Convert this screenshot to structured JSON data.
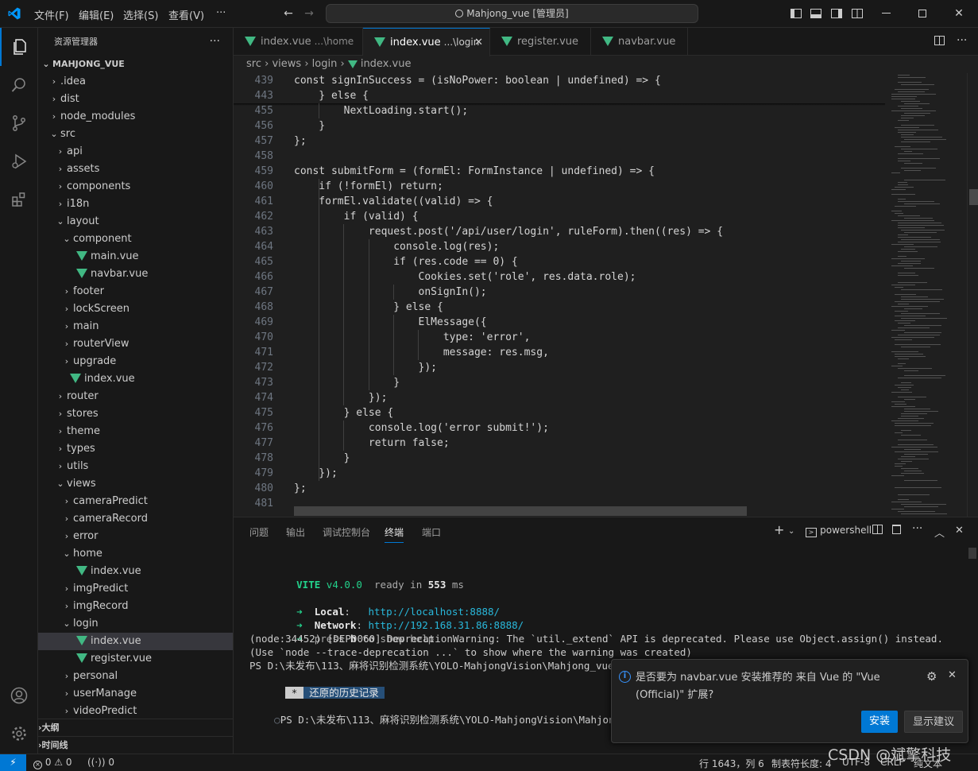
{
  "titlebar": {
    "menus": [
      "文件(F)",
      "编辑(E)",
      "选择(S)",
      "查看(V)",
      "···"
    ],
    "search": "Mahjong_vue [管理员]"
  },
  "sidebar": {
    "title": "资源管理器",
    "more": "···",
    "root": "MAHJONG_VUE",
    "items": [
      {
        "label": ".idea",
        "depth": 1,
        "kind": "folder",
        "open": false
      },
      {
        "label": "dist",
        "depth": 1,
        "kind": "folder",
        "open": false
      },
      {
        "label": "node_modules",
        "depth": 1,
        "kind": "folder",
        "open": false
      },
      {
        "label": "src",
        "depth": 1,
        "kind": "folder",
        "open": true
      },
      {
        "label": "api",
        "depth": 2,
        "kind": "folder",
        "open": false
      },
      {
        "label": "assets",
        "depth": 2,
        "kind": "folder",
        "open": false
      },
      {
        "label": "components",
        "depth": 2,
        "kind": "folder",
        "open": false
      },
      {
        "label": "i18n",
        "depth": 2,
        "kind": "folder",
        "open": false
      },
      {
        "label": "layout",
        "depth": 2,
        "kind": "folder",
        "open": true
      },
      {
        "label": "component",
        "depth": 3,
        "kind": "folder",
        "open": true
      },
      {
        "label": "main.vue",
        "depth": 4,
        "kind": "vue"
      },
      {
        "label": "navbar.vue",
        "depth": 4,
        "kind": "vue"
      },
      {
        "label": "footer",
        "depth": 3,
        "kind": "folder",
        "open": false
      },
      {
        "label": "lockScreen",
        "depth": 3,
        "kind": "folder",
        "open": false
      },
      {
        "label": "main",
        "depth": 3,
        "kind": "folder",
        "open": false
      },
      {
        "label": "routerView",
        "depth": 3,
        "kind": "folder",
        "open": false
      },
      {
        "label": "upgrade",
        "depth": 3,
        "kind": "folder",
        "open": false
      },
      {
        "label": "index.vue",
        "depth": 3,
        "kind": "vue"
      },
      {
        "label": "router",
        "depth": 2,
        "kind": "folder",
        "open": false
      },
      {
        "label": "stores",
        "depth": 2,
        "kind": "folder",
        "open": false
      },
      {
        "label": "theme",
        "depth": 2,
        "kind": "folder",
        "open": false
      },
      {
        "label": "types",
        "depth": 2,
        "kind": "folder",
        "open": false
      },
      {
        "label": "utils",
        "depth": 2,
        "kind": "folder",
        "open": false
      },
      {
        "label": "views",
        "depth": 2,
        "kind": "folder",
        "open": true
      },
      {
        "label": "cameraPredict",
        "depth": 3,
        "kind": "folder",
        "open": false
      },
      {
        "label": "cameraRecord",
        "depth": 3,
        "kind": "folder",
        "open": false
      },
      {
        "label": "error",
        "depth": 3,
        "kind": "folder",
        "open": false
      },
      {
        "label": "home",
        "depth": 3,
        "kind": "folder",
        "open": true
      },
      {
        "label": "index.vue",
        "depth": 4,
        "kind": "vue"
      },
      {
        "label": "imgPredict",
        "depth": 3,
        "kind": "folder",
        "open": false
      },
      {
        "label": "imgRecord",
        "depth": 3,
        "kind": "folder",
        "open": false
      },
      {
        "label": "login",
        "depth": 3,
        "kind": "folder",
        "open": true
      },
      {
        "label": "index.vue",
        "depth": 4,
        "kind": "vue",
        "selected": true
      },
      {
        "label": "register.vue",
        "depth": 4,
        "kind": "vue"
      },
      {
        "label": "personal",
        "depth": 3,
        "kind": "folder",
        "open": false
      },
      {
        "label": "userManage",
        "depth": 3,
        "kind": "folder",
        "open": false
      },
      {
        "label": "videoPredict",
        "depth": 3,
        "kind": "folder",
        "open": false
      }
    ],
    "outline": "大纲",
    "timeline": "时间线"
  },
  "tabs": [
    {
      "label": "index.vue",
      "desc": "...\\home",
      "active": false
    },
    {
      "label": "index.vue",
      "desc": "...\\login",
      "active": true
    },
    {
      "label": "register.vue",
      "desc": "",
      "active": false
    },
    {
      "label": "navbar.vue",
      "desc": "",
      "active": false
    }
  ],
  "breadcrumb": [
    "src",
    "views",
    "login",
    "index.vue"
  ],
  "code": [
    {
      "ln": "439",
      "text": "const signInSuccess = (isNoPower: boolean | undefined) => {"
    },
    {
      "ln": "443",
      "text": "    } else {"
    },
    {
      "ln": "455",
      "text": "        NextLoading.start();"
    },
    {
      "ln": "456",
      "text": "    }"
    },
    {
      "ln": "457",
      "text": "};"
    },
    {
      "ln": "458",
      "text": ""
    },
    {
      "ln": "459",
      "text": "const submitForm = (formEl: FormInstance | undefined) => {"
    },
    {
      "ln": "460",
      "text": "    if (!formEl) return;"
    },
    {
      "ln": "461",
      "text": "    formEl.validate((valid) => {"
    },
    {
      "ln": "462",
      "text": "        if (valid) {"
    },
    {
      "ln": "463",
      "text": "            request.post('/api/user/login', ruleForm).then((res) => {"
    },
    {
      "ln": "464",
      "text": "                console.log(res);"
    },
    {
      "ln": "465",
      "text": "                if (res.code == 0) {"
    },
    {
      "ln": "466",
      "text": "                    Cookies.set('role', res.data.role);"
    },
    {
      "ln": "467",
      "text": "                    onSignIn();"
    },
    {
      "ln": "468",
      "text": "                } else {"
    },
    {
      "ln": "469",
      "text": "                    ElMessage({"
    },
    {
      "ln": "470",
      "text": "                        type: 'error',"
    },
    {
      "ln": "471",
      "text": "                        message: res.msg,"
    },
    {
      "ln": "472",
      "text": "                    });"
    },
    {
      "ln": "473",
      "text": "                }"
    },
    {
      "ln": "474",
      "text": "            });"
    },
    {
      "ln": "475",
      "text": "        } else {"
    },
    {
      "ln": "476",
      "text": "            console.log('error submit!');"
    },
    {
      "ln": "477",
      "text": "            return false;"
    },
    {
      "ln": "478",
      "text": "        }"
    },
    {
      "ln": "479",
      "text": "    });"
    },
    {
      "ln": "480",
      "text": "};"
    },
    {
      "ln": "481",
      "text": ""
    }
  ],
  "panel": {
    "tabs": [
      "问题",
      "输出",
      "调试控制台",
      "终端",
      "端口"
    ],
    "active_tab": "终端",
    "shell": "powershell",
    "terminal": {
      "vite": "VITE",
      "version": "v4.0.0",
      "ready_prefix": "ready in",
      "ready_ms": "553",
      "ready_unit": "ms",
      "local_label": "Local",
      "local_url": "http://localhost:8888/",
      "network_label": "Network",
      "network_url": "http://192.168.31.86:8888/",
      "press_prefix": "press",
      "press_key": "h",
      "press_suffix": "to show help",
      "warn1": "(node:34452) [DEP0060] DeprecationWarning: The `util._extend` API is deprecated. Please use Object.assign() instead.",
      "warn2": "(Use `node --trace-deprecation ...` to show where the warning was created)",
      "ps1": "PS D:\\未发布\\113、麻将识别检测系统\\YOLO-MahjongVision\\Mahjong_vue",
      "restored_star": "*",
      "restored": "还原的历史记录",
      "ps2": "PS D:\\未发布\\113、麻将识别检测系统\\YOLO-MahjongVision\\Mahjong_vue"
    }
  },
  "notification": {
    "message": "是否要为 navbar.vue 安装推荐的 来自 Vue 的 \"Vue (Official)\" 扩展?",
    "install": "安装",
    "show_recommendations": "显示建议"
  },
  "statusbar": {
    "errors": "0",
    "warnings": "0",
    "ports": "0",
    "position": "行 1643，列 6",
    "tab_size": "制表符长度: 4",
    "encoding": "UTF-8",
    "eol": "CRLF",
    "language": "纯文本",
    "watermark": "CSDN @斌擎科技"
  },
  "colors": {
    "accent": "#0078d4",
    "vue_green": "#41b883",
    "terminal_green": "#23d18b",
    "terminal_cyan": "#29b8db"
  }
}
